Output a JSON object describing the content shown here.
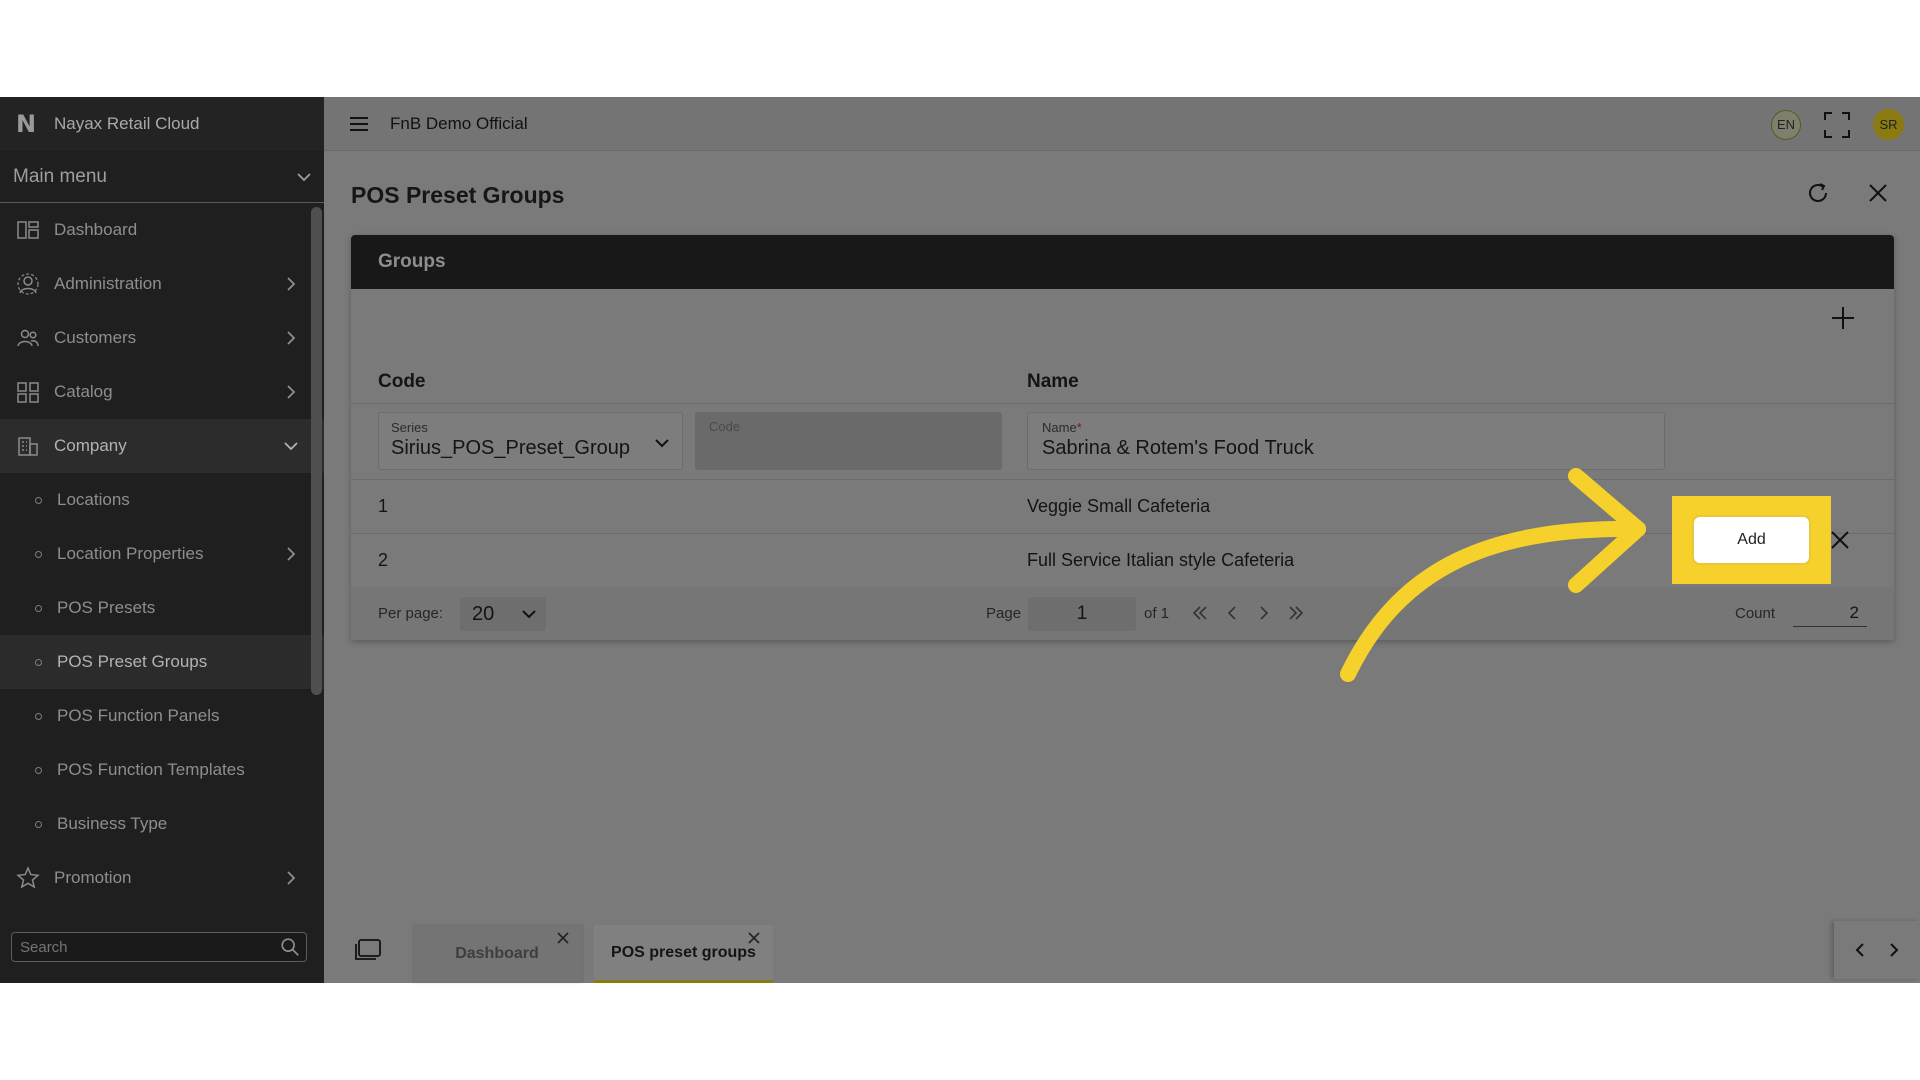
{
  "sidebar": {
    "brand_logo": "N",
    "brand_name": "Nayax Retail Cloud",
    "main_menu_label": "Main menu",
    "items": [
      {
        "label": "Dashboard",
        "icon": "dashboard-icon"
      },
      {
        "label": "Administration",
        "icon": "gear-user-icon"
      },
      {
        "label": "Customers",
        "icon": "users-icon"
      },
      {
        "label": "Catalog",
        "icon": "grid-icon"
      },
      {
        "label": "Company",
        "icon": "building-icon"
      }
    ],
    "sub_items": [
      {
        "label": "Locations"
      },
      {
        "label": "Location Properties"
      },
      {
        "label": "POS Presets"
      },
      {
        "label": "POS Preset Groups"
      },
      {
        "label": "POS Function Panels"
      },
      {
        "label": "POS Function Templates"
      },
      {
        "label": "Business Type"
      }
    ],
    "promotion_label": "Promotion",
    "search_placeholder": "Search"
  },
  "topbar": {
    "tenant": "FnB Demo Official",
    "language": "EN",
    "avatar_initials": "SR"
  },
  "page": {
    "title": "POS Preset Groups"
  },
  "panel": {
    "title": "Groups",
    "columns": {
      "code": "Code",
      "name": "Name"
    },
    "new_row": {
      "series_label": "Series",
      "series_value": "Sirius_POS_Preset_Group",
      "code_label": "Code",
      "name_label": "Name",
      "name_required_mark": "*",
      "name_value": "Sabrina & Rotem's Food Truck",
      "add_label": "Add"
    },
    "rows": [
      {
        "code": "1",
        "name": "Veggie Small Cafeteria"
      },
      {
        "code": "2",
        "name": "Full Service Italian style Cafeteria"
      }
    ],
    "footer": {
      "per_page_label": "Per page:",
      "per_page_value": "20",
      "page_label": "Page",
      "page_value": "1",
      "of_label": "of 1",
      "count_label": "Count",
      "count_value": "2"
    }
  },
  "tabs": [
    {
      "label": "Dashboard"
    },
    {
      "label": "POS preset groups"
    }
  ],
  "colors": {
    "highlight": "#f6d12b",
    "arrow": "#f6d12b",
    "sidebar_bg": "#1f1f1f",
    "overlay_bg": "#7a7a7a"
  }
}
